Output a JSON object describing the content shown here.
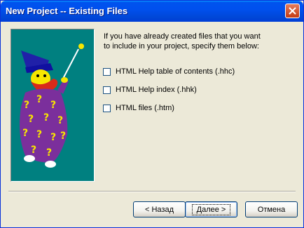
{
  "window": {
    "title": "New Project -- Existing Files"
  },
  "intro": {
    "line1": "If you have already created files that you want",
    "line2": "to include in your project, specify them below:"
  },
  "options": [
    {
      "label": "HTML Help table of contents (.hhc)",
      "checked": false
    },
    {
      "label": "HTML Help index (.hhk)",
      "checked": false
    },
    {
      "label": "HTML files (.htm)",
      "checked": false
    }
  ],
  "buttons": {
    "back": "< Назад",
    "next": "Далее >",
    "cancel": "Отмена"
  },
  "colors": {
    "wizard_bg": "#008080",
    "titlebar": "#0050ee",
    "robe": "#7b2f9c",
    "question_marks": "#f7e600"
  },
  "icons": {
    "close": "close-icon",
    "wizard": "wizard-illustration"
  }
}
